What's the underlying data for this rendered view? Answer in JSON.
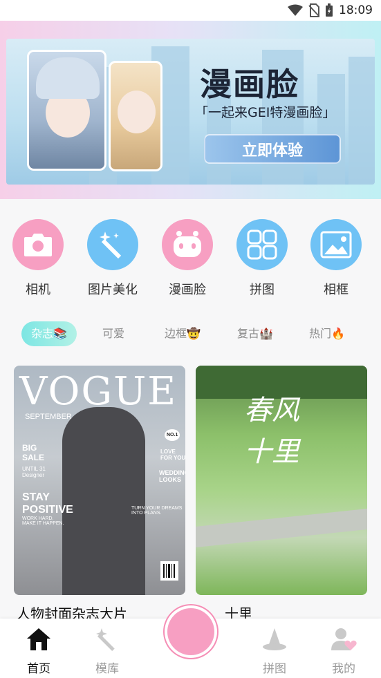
{
  "status_bar": {
    "time": "18:09"
  },
  "banner": {
    "title": "漫画脸",
    "subtitle": "「一起来GEI特漫画脸」",
    "button": "立即体验"
  },
  "shortcuts": [
    {
      "label": "相机",
      "icon": "camera-icon",
      "color": "#f79fc2"
    },
    {
      "label": "图片美化",
      "icon": "magic-wand-icon",
      "color": "#6fc2f5"
    },
    {
      "label": "漫画脸",
      "icon": "robot-face-icon",
      "color": "#f79fc2"
    },
    {
      "label": "拼图",
      "icon": "grid-icon",
      "color": "#6fc2f5"
    },
    {
      "label": "相框",
      "icon": "picture-frame-icon",
      "color": "#6fc2f5"
    }
  ],
  "tabs": [
    {
      "label": "杂志📚",
      "active": true
    },
    {
      "label": "可爱"
    },
    {
      "label": "边框🤠"
    },
    {
      "label": "复古🏰"
    },
    {
      "label": "热门🔥"
    }
  ],
  "feed": {
    "cards": [
      {
        "title": "人物封面杂志大片",
        "cover": {
          "masthead": "VOGUE",
          "month": "SEPTEMBER",
          "big_sale": "BIG\nSALE",
          "until": "UNTIL 31\nDesigner",
          "no1": "NO.1",
          "love_for_you": "LOVE\nFOR YOU",
          "wedding": "WEDDING\nLOOKS",
          "stay_positive": "STAY\nPOSITIVE",
          "work_hard": "WORK HARD.\nMAKE IT HAPPEN.",
          "turn_dreams": "TURN YOUR DREAMS\nINTO PLANS."
        }
      },
      {
        "title": "十里",
        "cover": {
          "calligraphy": "春风十里"
        }
      }
    ]
  },
  "bottom_nav": [
    {
      "label": "首页",
      "icon": "home-icon",
      "active": true
    },
    {
      "label": "模库",
      "icon": "magic-wand-icon"
    },
    {
      "label": "拼图",
      "icon": "wizard-hat-icon"
    },
    {
      "label": "我的",
      "icon": "user-heart-icon"
    }
  ]
}
